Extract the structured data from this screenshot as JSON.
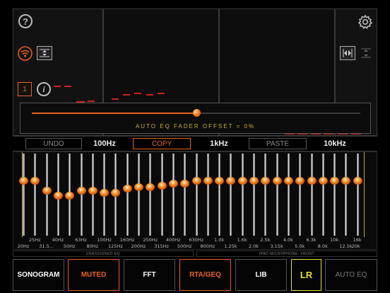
{
  "top": {
    "help_icon": "help-icon",
    "settings_icon": "gear-icon",
    "channel_number": "1",
    "info_icon": "info-icon"
  },
  "popup": {
    "label": "AUTO EQ FADER OFFSET = 0%",
    "offset_fraction": 0.5
  },
  "toolbar": {
    "undo": "UNDO",
    "freq1": "100Hz",
    "copy": "COPY",
    "freq2": "1kHz",
    "paste": "PASTE",
    "freq3": "10kHz"
  },
  "eq": {
    "levels": [
      0.67,
      0.67,
      0.55,
      0.49,
      0.49,
      0.55,
      0.55,
      0.52,
      0.52,
      0.57,
      0.59,
      0.59,
      0.61,
      0.63,
      0.63,
      0.67,
      0.67,
      0.67,
      0.67,
      0.67,
      0.67,
      0.67,
      0.67,
      0.67,
      0.67,
      0.67,
      0.67,
      0.67,
      0.67,
      0.67
    ],
    "upper_ticks": [
      "25Hz",
      "40Hz",
      "63Hz",
      "100Hz",
      "160Hz",
      "250Hz",
      "400Hz",
      "630Hz",
      "1.0k",
      "1.6k",
      "2.5k",
      "4.0k",
      "6.3k",
      "10k",
      "16k"
    ],
    "lower_ticks": [
      "20Hz",
      "31.5...",
      "50Hz",
      "80Hz",
      "125Hz",
      "200Hz",
      "315Hz",
      "500Hz",
      "800Hz",
      "1.25k",
      "2.0k",
      "3.15k",
      "5.0k",
      "8.0k",
      "12.5k",
      "20k"
    ]
  },
  "labels": {
    "left": "UNASSIGNED EQ",
    "right": "IPAD MICROPHONE: FRONT"
  },
  "bottom": {
    "sonogram": "SONOGRAM",
    "muted": "MUTED",
    "fft": "FFT",
    "rta_geq": "RTA/GEQ",
    "lib": "LIB",
    "lr": "LR",
    "auto_eq": "AUTO EQ"
  },
  "colors": {
    "accent_orange": "#e86020",
    "accent_yellow": "#e8e020",
    "auto_eq_yellow": "#c8b020",
    "marker_red": "#d02020"
  }
}
